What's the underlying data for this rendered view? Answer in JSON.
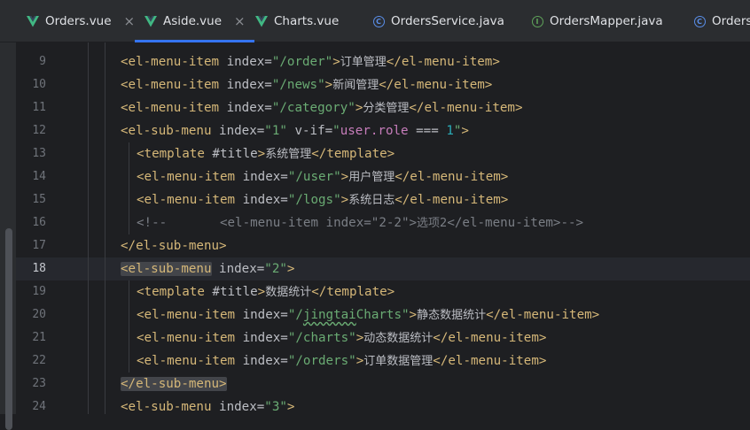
{
  "tabs": [
    {
      "label": "Orders.vue",
      "icon": "vue-icon",
      "active": false,
      "closable": true
    },
    {
      "label": "Aside.vue",
      "icon": "vue-icon",
      "active": true,
      "closable": true
    },
    {
      "label": "Charts.vue",
      "icon": "vue-icon",
      "active": false,
      "closable": false
    },
    {
      "label": "OrdersService.java",
      "icon": "java-class-icon",
      "active": false,
      "closable": false
    },
    {
      "label": "OrdersMapper.java",
      "icon": "java-interface-icon",
      "active": false,
      "closable": false
    },
    {
      "label": "Orders.",
      "icon": "java-class-icon",
      "active": false,
      "closable": false
    }
  ],
  "close_glyph": "×",
  "editor": {
    "current_line": 18,
    "lines": [
      {
        "n": 9,
        "parts": [
          [
            "tg",
            "<el-menu-item "
          ],
          [
            "at",
            "index="
          ],
          [
            "vl",
            "\"/order\""
          ],
          [
            "tg",
            ">"
          ],
          [
            "cjk",
            "订单管理"
          ],
          [
            "tg",
            "</el-menu-item>"
          ]
        ]
      },
      {
        "n": 10,
        "parts": [
          [
            "tg",
            "<el-menu-item "
          ],
          [
            "at",
            "index="
          ],
          [
            "vl",
            "\"/news\""
          ],
          [
            "tg",
            ">"
          ],
          [
            "cjk",
            "新闻管理"
          ],
          [
            "tg",
            "</el-menu-item>"
          ]
        ]
      },
      {
        "n": 11,
        "parts": [
          [
            "tg",
            "<el-menu-item "
          ],
          [
            "at",
            "index="
          ],
          [
            "vl",
            "\"/category\""
          ],
          [
            "tg",
            ">"
          ],
          [
            "cjk",
            "分类管理"
          ],
          [
            "tg",
            "</el-menu-item>"
          ]
        ]
      },
      {
        "n": 12,
        "parts": [
          [
            "tg",
            "<el-sub-menu "
          ],
          [
            "at",
            "index="
          ],
          [
            "vl",
            "\"1\""
          ],
          [
            "at",
            " v-if="
          ],
          [
            "vl",
            "\""
          ],
          [
            "vif-val",
            "user.role"
          ],
          [
            "op",
            " === "
          ],
          [
            "num",
            "1"
          ],
          [
            "vl",
            "\""
          ],
          [
            "tg",
            ">"
          ]
        ]
      },
      {
        "n": 13,
        "parts": [
          [
            "tg",
            "<template "
          ],
          [
            "at",
            "#title"
          ],
          [
            "tg",
            ">"
          ],
          [
            "cjk",
            "系统管理"
          ],
          [
            "tg",
            "</template>"
          ]
        ]
      },
      {
        "n": 14,
        "parts": [
          [
            "tg",
            "<el-menu-item "
          ],
          [
            "at",
            "index="
          ],
          [
            "vl",
            "\"/user\""
          ],
          [
            "tg",
            ">"
          ],
          [
            "cjk",
            "用户管理"
          ],
          [
            "tg",
            "</el-menu-item>"
          ]
        ]
      },
      {
        "n": 15,
        "parts": [
          [
            "tg",
            "<el-menu-item "
          ],
          [
            "at",
            "index="
          ],
          [
            "vl",
            "\"/logs\""
          ],
          [
            "tg",
            ">"
          ],
          [
            "cjk",
            "系统日志"
          ],
          [
            "tg",
            "</el-menu-item>"
          ]
        ]
      },
      {
        "n": 16,
        "parts": [
          [
            "cm",
            "<!--       <el-menu-item index=\"2-2\">"
          ],
          [
            "cmcjk",
            "选项2"
          ],
          [
            "cm",
            "</el-menu-item>-->"
          ]
        ]
      },
      {
        "n": 17,
        "parts": [
          [
            "tg",
            "</el-sub-menu>"
          ]
        ]
      },
      {
        "n": 18,
        "parts": [
          [
            "tgm",
            "<el-sub-menu"
          ],
          [
            "tg",
            " "
          ],
          [
            "at",
            "index="
          ],
          [
            "vl",
            "\"2\""
          ],
          [
            "tg",
            ">"
          ]
        ]
      },
      {
        "n": 19,
        "parts": [
          [
            "tg",
            "<template "
          ],
          [
            "at",
            "#title"
          ],
          [
            "tg",
            ">"
          ],
          [
            "cjk",
            "数据统计"
          ],
          [
            "tg",
            "</template>"
          ]
        ]
      },
      {
        "n": 20,
        "parts": [
          [
            "tg",
            "<el-menu-item "
          ],
          [
            "at",
            "index="
          ],
          [
            "vl",
            "\"/"
          ],
          [
            "vlw",
            "jingtai"
          ],
          [
            "vl",
            "Charts\""
          ],
          [
            "tg",
            ">"
          ],
          [
            "cjk",
            "静态数据统计"
          ],
          [
            "tg",
            "</el-menu-item>"
          ]
        ]
      },
      {
        "n": 21,
        "parts": [
          [
            "tg",
            "<el-menu-item "
          ],
          [
            "at",
            "index="
          ],
          [
            "vl",
            "\"/charts\""
          ],
          [
            "tg",
            ">"
          ],
          [
            "cjk",
            "动态数据统计"
          ],
          [
            "tg",
            "</el-menu-item>"
          ]
        ]
      },
      {
        "n": 22,
        "parts": [
          [
            "tg",
            "<el-menu-item "
          ],
          [
            "at",
            "index="
          ],
          [
            "vl",
            "\"/orders\""
          ],
          [
            "tg",
            ">"
          ],
          [
            "cjk",
            "订单数据管理"
          ],
          [
            "tg",
            "</el-menu-item>"
          ]
        ]
      },
      {
        "n": 23,
        "parts": [
          [
            "tgm",
            "</el-sub-menu>"
          ]
        ]
      },
      {
        "n": 24,
        "parts": [
          [
            "tg",
            "<el-sub-menu "
          ],
          [
            "at",
            "index="
          ],
          [
            "vl",
            "\"3\""
          ],
          [
            "tg",
            ">"
          ]
        ]
      }
    ]
  },
  "colors": {
    "background": "#1e1f22",
    "tab_bar": "#2b2d30",
    "accent": "#3574f0",
    "tag": "#d5b778",
    "string": "#6aab73",
    "comment": "#7a7e85"
  }
}
